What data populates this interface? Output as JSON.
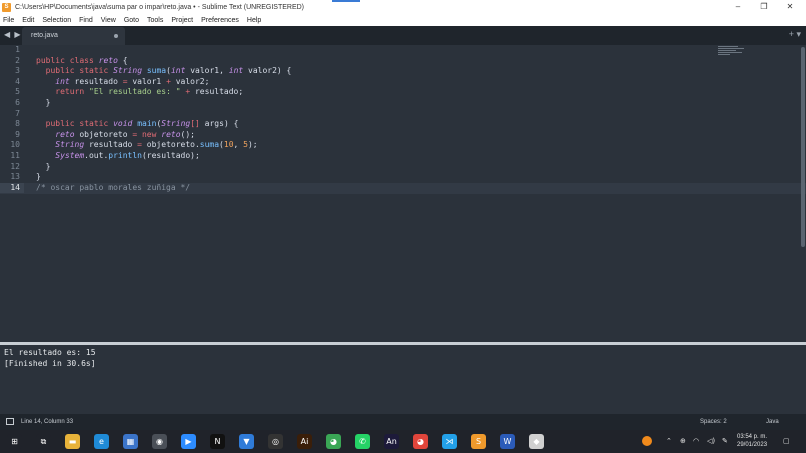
{
  "window": {
    "title": "C:\\Users\\HP\\Documents\\java\\suma par o impar\\reto.java • - Sublime Text (UNREGISTERED)",
    "controls": [
      "–",
      "❐",
      "✕"
    ]
  },
  "menu": [
    "File",
    "Edit",
    "Selection",
    "Find",
    "View",
    "Goto",
    "Tools",
    "Project",
    "Preferences",
    "Help"
  ],
  "tab": {
    "label": "reto.java",
    "nav": "◀ ▶",
    "right_icons": "+ ▾"
  },
  "editor": {
    "line_numbers": [
      "1",
      "2",
      "3",
      "4",
      "5",
      "6",
      "7",
      "8",
      "9",
      "10",
      "11",
      "12",
      "13",
      "14"
    ],
    "active_line": 14,
    "lines": [
      "",
      "public class reto {",
      "  public static String suma(int valor1, int valor2) {",
      "    int resultado = valor1 + valor2;",
      "    return \"El resultado es: \" + resultado;",
      "  }",
      "",
      "  public static void main(String[] args) {",
      "    reto objetoreto = new reto();",
      "    String resultado = objetoreto.suma(10, 5);",
      "    System.out.println(resultado);",
      "  }",
      "}",
      "/* oscar pablo morales zuñiga */"
    ]
  },
  "console": {
    "output": [
      "El resultado es: 15",
      "[Finished in 30.6s]"
    ]
  },
  "status": {
    "position": "Line 14, Column 33",
    "spaces": "Spaces: 2",
    "syntax": "Java"
  },
  "taskbar": {
    "apps": [
      {
        "icon": "windows-start-icon",
        "glyph": "⊞",
        "color": "#20232a"
      },
      {
        "icon": "task-view-icon",
        "glyph": "⧉",
        "color": "#20232a"
      },
      {
        "icon": "file-explorer-icon",
        "glyph": "▬",
        "color": "#e8b33a"
      },
      {
        "icon": "edge-icon",
        "glyph": "e",
        "color": "#1f8ad6"
      },
      {
        "icon": "store-icon",
        "glyph": "▦",
        "color": "#3b74c9"
      },
      {
        "icon": "camera-icon",
        "glyph": "◉",
        "color": "#4a4f57"
      },
      {
        "icon": "zoom-icon",
        "glyph": "▶",
        "color": "#2d8cff"
      },
      {
        "icon": "netflix-icon",
        "glyph": "N",
        "color": "#111111"
      },
      {
        "icon": "bookmark-app-icon",
        "glyph": "▼",
        "color": "#2f7bd8"
      },
      {
        "icon": "obs-icon",
        "glyph": "◎",
        "color": "#333333"
      },
      {
        "icon": "illustrator-icon",
        "glyph": "Ai",
        "color": "#3a1e09"
      },
      {
        "icon": "chrome-icon",
        "glyph": "◕",
        "color": "#3aa655"
      },
      {
        "icon": "whatsapp-icon",
        "glyph": "✆",
        "color": "#25d366"
      },
      {
        "icon": "animate-icon",
        "glyph": "An",
        "color": "#1d1a3a"
      },
      {
        "icon": "chrome-icon-2",
        "glyph": "◕",
        "color": "#e0453b"
      },
      {
        "icon": "vscode-icon",
        "glyph": "⋊",
        "color": "#23a0e8"
      },
      {
        "icon": "sublime-icon",
        "glyph": "S",
        "color": "#f09a2c"
      },
      {
        "icon": "word-icon",
        "glyph": "W",
        "color": "#2b5bb8"
      },
      {
        "icon": "app-icon",
        "glyph": "◆",
        "color": "#d0d0d0"
      }
    ],
    "clock_time": "03:54 p. m.",
    "clock_date": "29/01/2023"
  }
}
